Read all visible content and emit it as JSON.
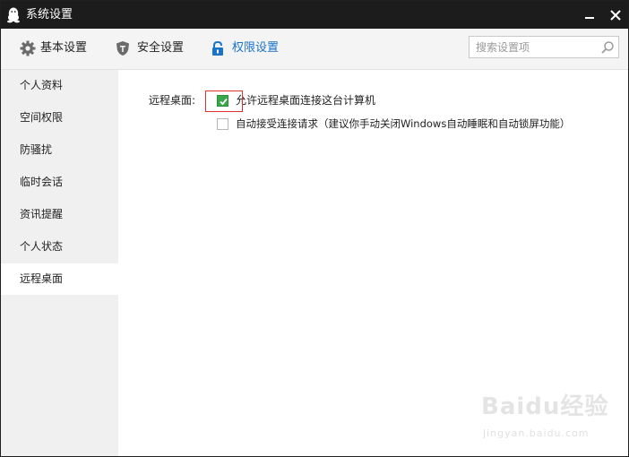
{
  "window": {
    "title": "系统设置",
    "app_icon": "qq-penguin-icon",
    "controls": {
      "minimize_icon": "minimize-icon",
      "close_icon": "close-icon"
    }
  },
  "toolbar": {
    "tabs": [
      {
        "label": "基本设置",
        "icon": "gear-icon",
        "active": false
      },
      {
        "label": "安全设置",
        "icon": "shield-icon",
        "active": false
      },
      {
        "label": "权限设置",
        "icon": "lock-icon",
        "active": true
      }
    ],
    "search": {
      "placeholder": "搜索设置项",
      "value": "",
      "icon": "search-icon"
    }
  },
  "sidebar": {
    "items": [
      {
        "label": "个人资料",
        "active": false
      },
      {
        "label": "空间权限",
        "active": false
      },
      {
        "label": "防骚扰",
        "active": false
      },
      {
        "label": "临时会话",
        "active": false
      },
      {
        "label": "资讯提醒",
        "active": false
      },
      {
        "label": "个人状态",
        "active": false
      },
      {
        "label": "远程桌面",
        "active": true
      }
    ]
  },
  "main": {
    "section_label": "远程桌面:",
    "options": [
      {
        "label": "允许远程桌面连接这台计算机",
        "checked": true
      },
      {
        "label": "自动接受连接请求（建议你手动关闭Windows自动睡眠和自动锁屏功能）",
        "checked": false
      }
    ]
  },
  "watermark": {
    "logo": "Baidu经验",
    "url": "jingyan.baidu.com"
  },
  "colors": {
    "titlebar": "#1c1c1c",
    "accent": "#1a73c9",
    "checkbox_checked": "#3aa64a",
    "highlight_box": "#e0302b",
    "sidebar_bg": "#f0f0f0",
    "toolbar_bg": "#f4f4f4"
  }
}
